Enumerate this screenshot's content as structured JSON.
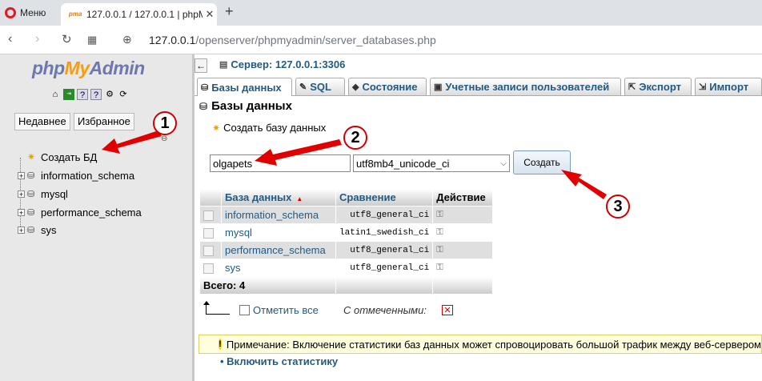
{
  "browser": {
    "menu_label": "Меню",
    "tab_title": "127.0.0.1 / 127.0.0.1 | phpMy",
    "url_host": "127.0.0.1",
    "url_path": "/openserver/phpmyadmin/server_databases.php"
  },
  "sidebar": {
    "logo_php": "php",
    "logo_my": "My",
    "logo_admin": "Admin",
    "recent_label": "Недавнее",
    "favorites_label": "Избранное",
    "tree": [
      {
        "label": "Создать БД"
      },
      {
        "label": "information_schema"
      },
      {
        "label": "mysql"
      },
      {
        "label": "performance_schema"
      },
      {
        "label": "sys"
      }
    ]
  },
  "header": {
    "server_label": "Сервер: 127.0.0.1:3306"
  },
  "tabs": [
    {
      "label": "Базы данных"
    },
    {
      "label": "SQL"
    },
    {
      "label": "Состояние"
    },
    {
      "label": "Учетные записи пользователей"
    },
    {
      "label": "Экспорт"
    },
    {
      "label": "Импорт"
    }
  ],
  "main": {
    "title": "Базы данных",
    "create_db_label": "Создать базу данных",
    "db_name_value": "olgapets",
    "collation_value": "utf8mb4_unicode_ci",
    "create_button": "Создать"
  },
  "table": {
    "headers": {
      "database": "База данных",
      "collation": "Сравнение",
      "action": "Действие"
    },
    "rows": [
      {
        "name": "information_schema",
        "collation": "utf8_general_ci"
      },
      {
        "name": "mysql",
        "collation": "latin1_swedish_ci"
      },
      {
        "name": "performance_schema",
        "collation": "utf8_general_ci"
      },
      {
        "name": "sys",
        "collation": "utf8_general_ci"
      }
    ],
    "total_label": "Всего: 4"
  },
  "bulk": {
    "check_all_label": "Отметить все",
    "with_selected_label": "С отмеченными:"
  },
  "notice": {
    "text": "Примечание: Включение статистики баз данных может спровоцировать большой трафик между веб-сервером"
  },
  "enable_stats_label": "Включить статистику",
  "annotations": {
    "badge_1": "1",
    "badge_2": "2",
    "badge_3": "3",
    "arrow_color": "#e00000"
  }
}
